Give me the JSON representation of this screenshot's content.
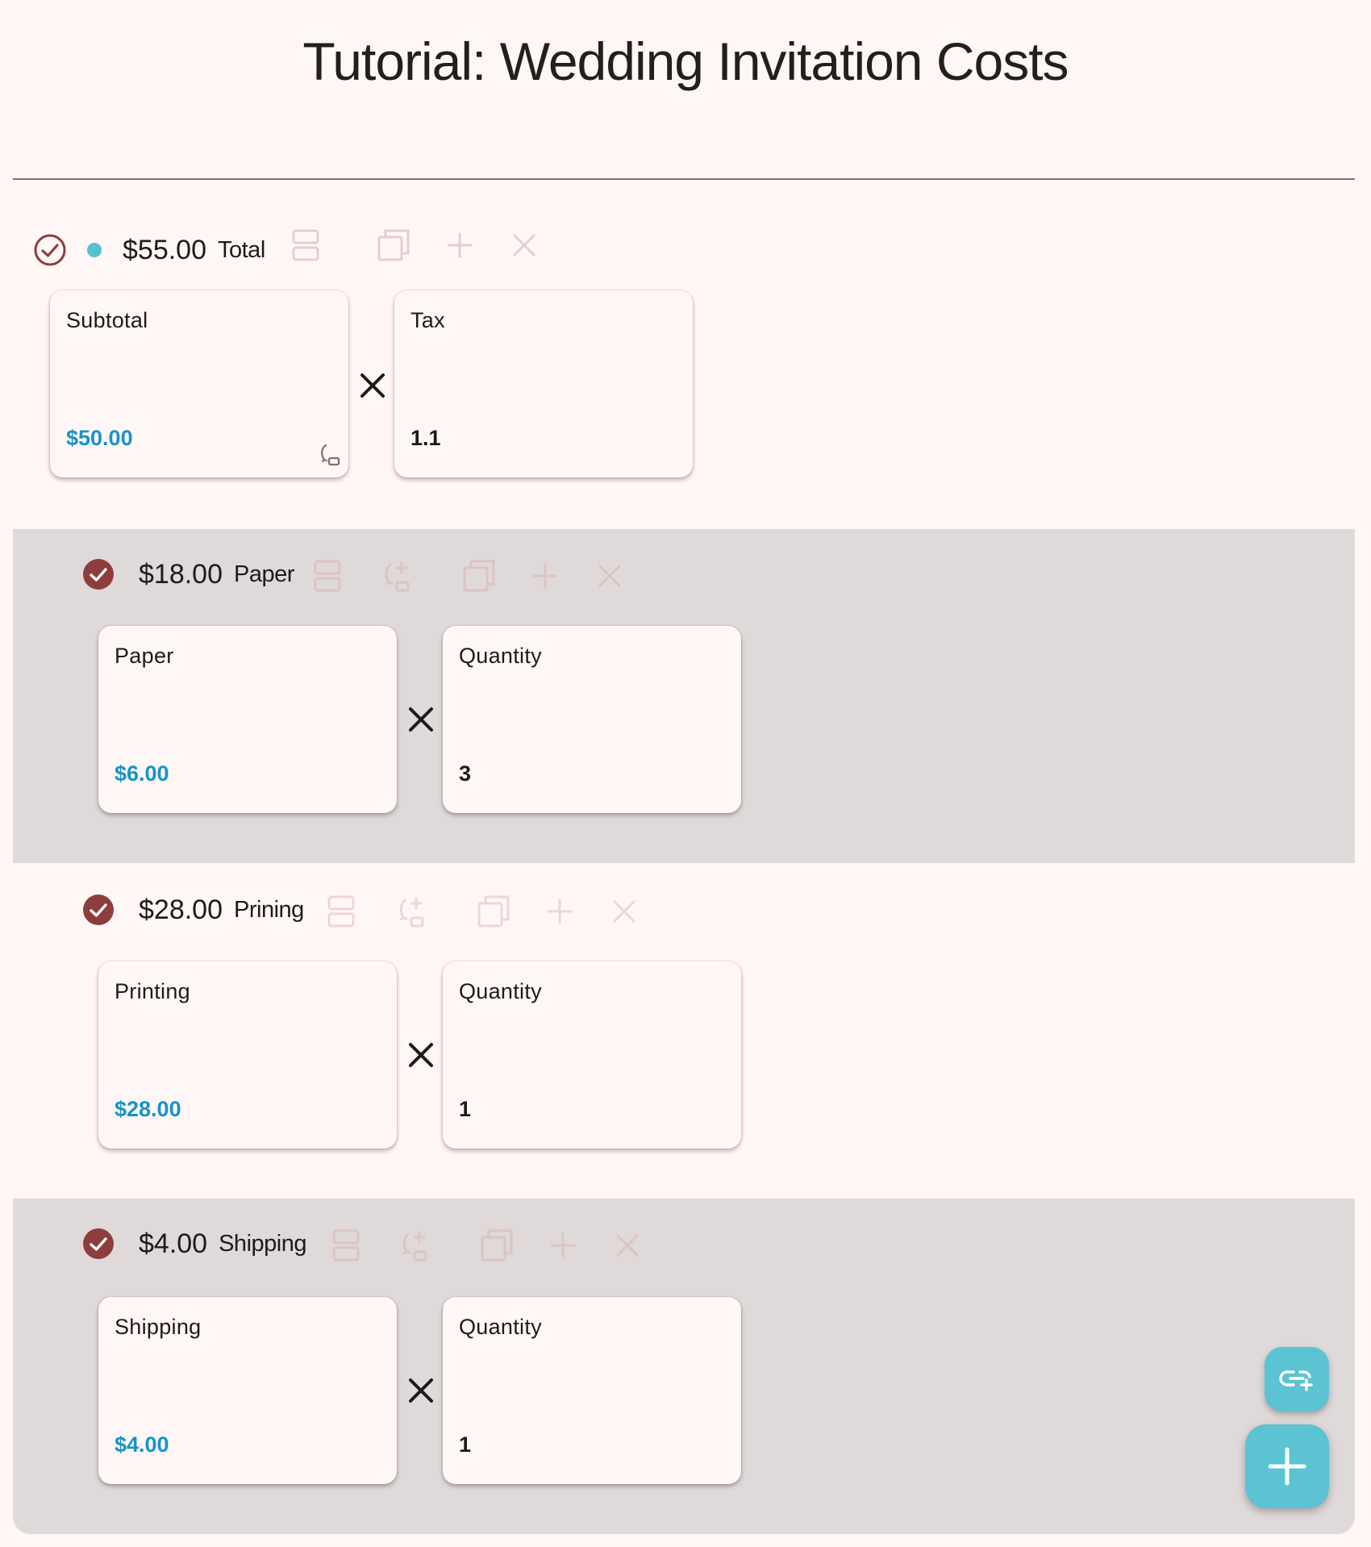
{
  "header": {
    "title": "Tutorial: Wedding Invitation Costs"
  },
  "colors": {
    "accent": "#5bc3d1",
    "money": "#1793c8",
    "check": "#8c3d3d",
    "shaded_row": "#e0d9d9",
    "background": "#fff7f5"
  },
  "icons": {
    "check": "check-circle-icon",
    "split": "split-icon",
    "link": "link-icon",
    "copy": "copy-icon",
    "add": "plus-icon",
    "remove": "close-icon",
    "operator": "times-icon",
    "fab_small": "link-add-icon",
    "fab_large": "plus-icon"
  },
  "items": [
    {
      "amount": "$55.00",
      "label": "Total",
      "active": true,
      "left_card": {
        "title": "Subtotal",
        "value": "$50.00"
      },
      "right_card": {
        "title": "Tax",
        "value": "1.1"
      }
    },
    {
      "amount": "$18.00",
      "label": "Paper",
      "active": false,
      "left_card": {
        "title": "Paper",
        "value": "$6.00"
      },
      "right_card": {
        "title": "Quantity",
        "value": "3"
      }
    },
    {
      "amount": "$28.00",
      "label": "Prining",
      "active": false,
      "left_card": {
        "title": "Printing",
        "value": "$28.00"
      },
      "right_card": {
        "title": "Quantity",
        "value": "1"
      }
    },
    {
      "amount": "$4.00",
      "label": "Shipping",
      "active": false,
      "left_card": {
        "title": "Shipping",
        "value": "$4.00"
      },
      "right_card": {
        "title": "Quantity",
        "value": "1"
      }
    }
  ]
}
